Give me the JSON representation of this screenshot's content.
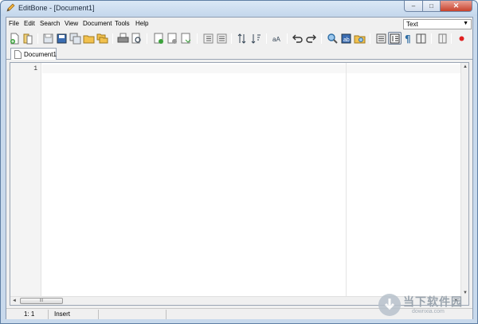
{
  "window": {
    "title": "EditBone - [Document1]",
    "close_glyph": "✕",
    "maximize_glyph": "□",
    "minimize_glyph": "–"
  },
  "menu": {
    "items": [
      "File",
      "Edit",
      "Search",
      "View",
      "Document",
      "Tools",
      "Help"
    ]
  },
  "highlighter": {
    "selected": "Text"
  },
  "toolbar": {
    "buttons": [
      {
        "name": "new-document",
        "icon": "new-document-icon"
      },
      {
        "name": "open-file",
        "icon": "open-file-icon"
      },
      {
        "name": "save",
        "icon": "save-icon"
      },
      {
        "name": "save-as",
        "icon": "save-as-icon"
      },
      {
        "name": "save-all",
        "icon": "save-all-icon"
      },
      {
        "name": "open-folder",
        "icon": "folder-icon"
      },
      {
        "name": "folders",
        "icon": "folders-icon"
      },
      {
        "name": "print",
        "icon": "print-icon"
      },
      {
        "name": "print-preview",
        "icon": "print-preview-icon"
      },
      {
        "name": "compare",
        "icon": "compare-icon"
      },
      {
        "name": "find-in-files",
        "icon": "find-in-files-icon"
      },
      {
        "name": "replace-in-files",
        "icon": "replace-in-files-icon"
      },
      {
        "name": "indent",
        "icon": "indent-icon"
      },
      {
        "name": "outdent",
        "icon": "outdent-icon"
      },
      {
        "name": "sort-ascending",
        "icon": "sort-ascending-icon"
      },
      {
        "name": "sort-descending",
        "icon": "sort-descending-icon"
      },
      {
        "name": "case",
        "icon": "case-icon"
      },
      {
        "name": "undo",
        "icon": "undo-icon"
      },
      {
        "name": "redo",
        "icon": "redo-icon"
      },
      {
        "name": "search",
        "icon": "search-icon"
      },
      {
        "name": "find-replace",
        "icon": "find-replace-icon"
      },
      {
        "name": "find-folder",
        "icon": "find-folder-icon"
      },
      {
        "name": "toggle-panel",
        "icon": "panel-icon"
      },
      {
        "name": "line-numbers",
        "icon": "line-numbers-icon",
        "pressed": true
      },
      {
        "name": "special-chars",
        "icon": "pilcrow-icon"
      },
      {
        "name": "split-view",
        "icon": "split-view-icon"
      },
      {
        "name": "copy-doc",
        "icon": "copy-icon"
      },
      {
        "name": "record-macro",
        "icon": "record-icon"
      }
    ]
  },
  "tabs": [
    {
      "label": "Document1",
      "icon": "document-icon"
    }
  ],
  "editor": {
    "line_numbers": [
      "1"
    ],
    "hscroll_grip": "III",
    "scroll_up": "▲",
    "scroll_down": "▼",
    "scroll_left": "◄",
    "scroll_right": "►"
  },
  "statusbar": {
    "position": "1: 1",
    "mode": "Insert"
  },
  "watermark": {
    "text": "当下软件园",
    "url": "downxia.com"
  },
  "colors": {
    "titlebar": "#c4d7ec",
    "close_button": "#c8412b",
    "chrome": "#f0f0f0",
    "record": "#e02020"
  }
}
